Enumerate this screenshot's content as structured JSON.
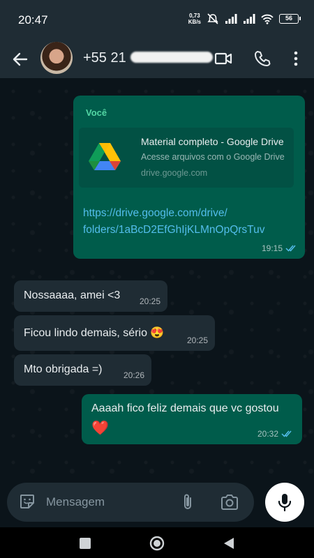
{
  "status_bar": {
    "time": "20:47",
    "net_speed_value": "0,73",
    "net_speed_unit": "KB/s",
    "battery": "56"
  },
  "header": {
    "contact_name": "+55 21"
  },
  "messages": {
    "shared": {
      "sender": "Você",
      "link_title": "Material completo - Google Drive",
      "link_description": "Acesse arquivos com o Google Drive",
      "link_domain": "drive.google.com",
      "url_line1": "https://drive.google.com/drive/",
      "url_line2": "folders/1aBcD2EfGhIjKLMnOpQrsTuv",
      "time": "19:15"
    },
    "in1": {
      "text": "Nossaaaa, amei <3",
      "time": "20:25"
    },
    "in2": {
      "text": "Ficou lindo demais, sério 😍",
      "time": "20:25"
    },
    "in3": {
      "text": "Mto obrigada =)",
      "time": "20:26"
    },
    "out1": {
      "text": "Aaaah fico feliz demais que vc gostou",
      "emoji": "❤️",
      "time": "20:32"
    }
  },
  "composer": {
    "placeholder": "Mensagem"
  },
  "colors": {
    "outgoing": "#005c4b",
    "incoming": "#1f2c34",
    "background": "#0b141a",
    "accent": "#53bdeb",
    "read_ticks": "#53bdeb"
  },
  "icons": [
    "back-arrow",
    "video-call",
    "voice-call",
    "more-vert",
    "sticker",
    "paperclip",
    "camera",
    "microphone",
    "nav-recents",
    "nav-home",
    "nav-back"
  ]
}
